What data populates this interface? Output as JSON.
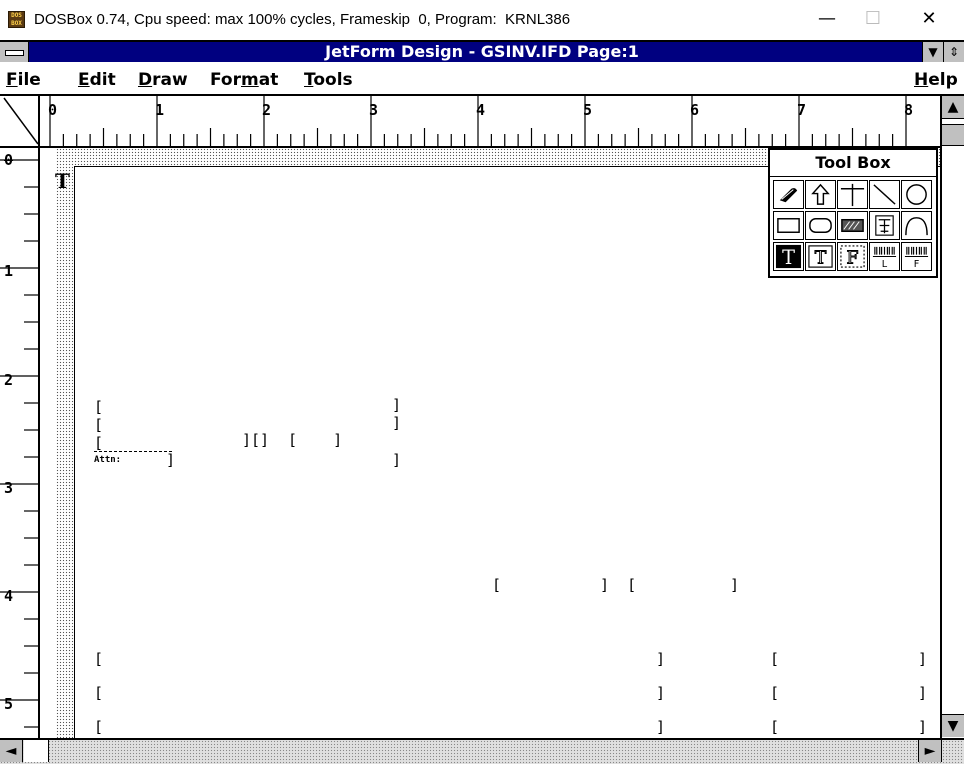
{
  "host": {
    "title": "DOSBox 0.74, Cpu speed: max 100% cycles, Frameskip  0, Program:  KRNL386",
    "icon_text": "DOS BOX",
    "minimize": "—",
    "maximize": "☐",
    "close": "✕"
  },
  "app": {
    "title": "JetForm Design - GSINV.IFD Page:1",
    "caption_min": "▼",
    "caption_max": "⇕"
  },
  "menu": {
    "file": {
      "hot": "F",
      "rest": "ile"
    },
    "edit": {
      "hot": "E",
      "rest": "dit"
    },
    "draw": {
      "hot": "D",
      "rest": "raw"
    },
    "format": {
      "pre": "For",
      "hot": "m",
      "rest": "at"
    },
    "tools": {
      "hot": "T",
      "rest": "ools"
    },
    "help": {
      "hot": "H",
      "rest": "elp"
    }
  },
  "ruler": {
    "h_labels": [
      "0",
      "1",
      "2",
      "3",
      "4",
      "5",
      "6",
      "7",
      "8"
    ],
    "v_labels": [
      "0",
      "1",
      "2",
      "3",
      "4",
      "5"
    ]
  },
  "toolbox": {
    "title": "Tool Box",
    "tools": [
      "paint-icon",
      "arrow-up-icon",
      "vertical-line-icon",
      "diagonal-line-icon",
      "circle-icon",
      "rectangle-icon",
      "rounded-rectangle-icon",
      "hatched-box-icon",
      "logo-icon",
      "arc-icon",
      "text-filled-icon",
      "text-box-icon",
      "field-icon",
      "barcode-l-icon",
      "barcode-f-icon"
    ],
    "labels": {
      "text": "T",
      "field": "F",
      "bar_l": "L",
      "bar_f": "F"
    }
  },
  "page": {
    "cursor_glyph": "T",
    "small_label": "Attn:",
    "fields": {
      "l": "[",
      "r": "]",
      "pair": "][]",
      "pair2": "[    ]",
      "mid": "]  ["
    }
  },
  "scroll": {
    "up": "▲",
    "down": "▼",
    "left": "◄",
    "right": "►"
  }
}
